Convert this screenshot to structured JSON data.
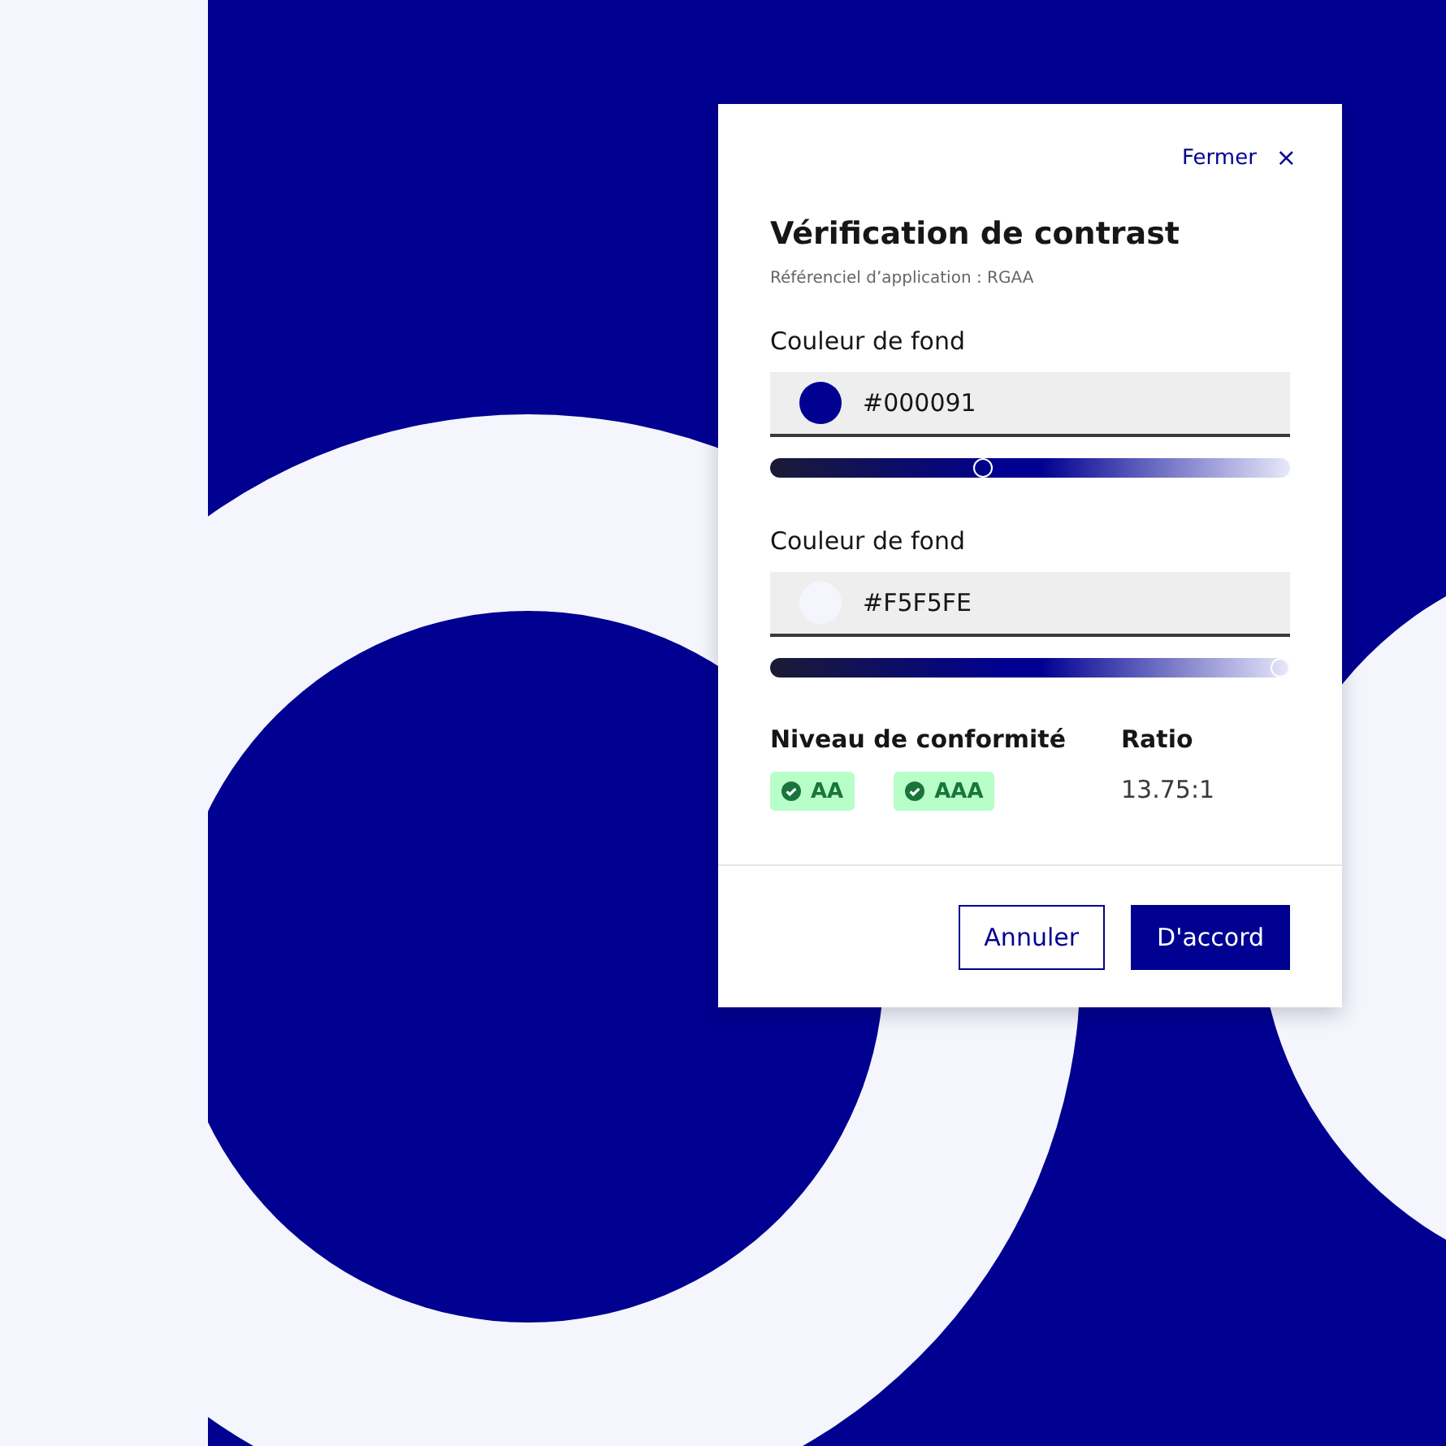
{
  "dialog": {
    "close": {
      "label": "Fermer",
      "icon": "×"
    },
    "title": "Vérification de contrast",
    "subtitle": "Référenciel d’application : RGAA",
    "colors": [
      {
        "label": "Couleur de fond",
        "value": "#000091",
        "color": "#000091",
        "level": 0.41
      },
      {
        "label": "Couleur de fond",
        "value": "#F5F5FE",
        "color": "#f5f5fe",
        "level": 0.98
      }
    ],
    "compliance": {
      "heading": "Niveau de conformité",
      "badges": [
        {
          "label": "AA",
          "passed": true
        },
        {
          "label": "AAA",
          "passed": true
        }
      ]
    },
    "ratio": {
      "heading": "Ratio",
      "value": "13.75:1"
    },
    "buttons": [
      {
        "label": "Annuler",
        "kind": "secondary"
      },
      {
        "label": "D'accord",
        "kind": "primary"
      }
    ]
  }
}
